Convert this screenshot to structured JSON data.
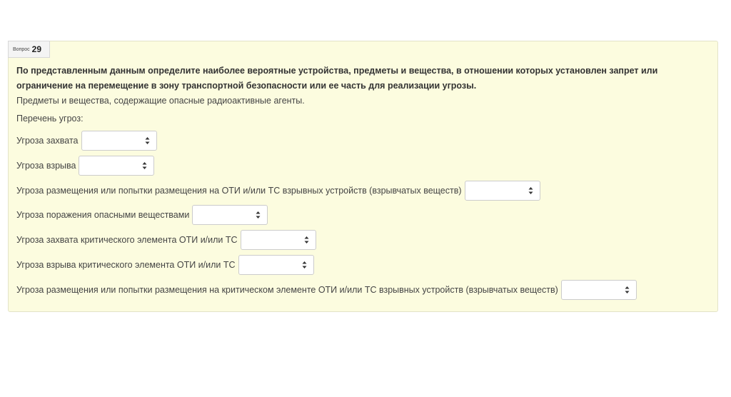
{
  "question": {
    "label_prefix": "Вопрос",
    "number": "29",
    "text": "По представленным данным определите наиболее вероятные устройства, предметы и вещества, в отношении которых установлен запрет или ограничение на перемещение в зону транспортной безопасности или ее часть для реализации угрозы.",
    "subtitle": "Предметы и вещества, содержащие опасные радиоактивные агенты.",
    "threats_heading": "Перечень угроз:"
  },
  "threats": [
    {
      "label": "Угроза захвата",
      "selected": ""
    },
    {
      "label": "Угроза взрыва",
      "selected": ""
    },
    {
      "label": "Угроза размещения или попытки размещения на ОТИ и/или ТС взрывных устройств (взрывчатых веществ)",
      "selected": ""
    },
    {
      "label": "Угроза поражения опасными веществами",
      "selected": ""
    },
    {
      "label": "Угроза захвата критического элемента ОТИ и/или ТС",
      "selected": ""
    },
    {
      "label": "Угроза взрыва критического элемента ОТИ и/или ТС",
      "selected": ""
    },
    {
      "label": "Угроза размещения или попытки размещения на критическом элементе ОТИ и/или ТС взрывных устройств (взрывчатых веществ)",
      "selected": ""
    }
  ],
  "icons": {
    "select_arrow": "up-down-caret-icon"
  }
}
